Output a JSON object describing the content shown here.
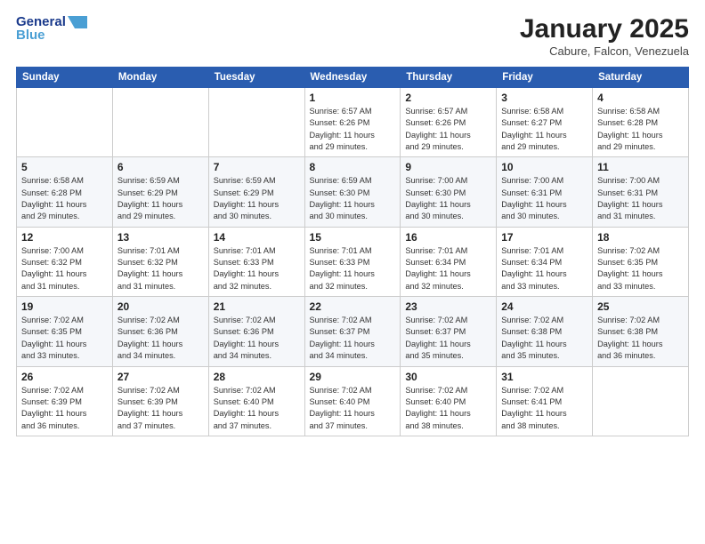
{
  "logo": {
    "line1": "General",
    "line2": "Blue"
  },
  "title": "January 2025",
  "subtitle": "Cabure, Falcon, Venezuela",
  "days_of_week": [
    "Sunday",
    "Monday",
    "Tuesday",
    "Wednesday",
    "Thursday",
    "Friday",
    "Saturday"
  ],
  "weeks": [
    [
      {
        "num": "",
        "info": ""
      },
      {
        "num": "",
        "info": ""
      },
      {
        "num": "",
        "info": ""
      },
      {
        "num": "1",
        "info": "Sunrise: 6:57 AM\nSunset: 6:26 PM\nDaylight: 11 hours\nand 29 minutes."
      },
      {
        "num": "2",
        "info": "Sunrise: 6:57 AM\nSunset: 6:26 PM\nDaylight: 11 hours\nand 29 minutes."
      },
      {
        "num": "3",
        "info": "Sunrise: 6:58 AM\nSunset: 6:27 PM\nDaylight: 11 hours\nand 29 minutes."
      },
      {
        "num": "4",
        "info": "Sunrise: 6:58 AM\nSunset: 6:28 PM\nDaylight: 11 hours\nand 29 minutes."
      }
    ],
    [
      {
        "num": "5",
        "info": "Sunrise: 6:58 AM\nSunset: 6:28 PM\nDaylight: 11 hours\nand 29 minutes."
      },
      {
        "num": "6",
        "info": "Sunrise: 6:59 AM\nSunset: 6:29 PM\nDaylight: 11 hours\nand 29 minutes."
      },
      {
        "num": "7",
        "info": "Sunrise: 6:59 AM\nSunset: 6:29 PM\nDaylight: 11 hours\nand 30 minutes."
      },
      {
        "num": "8",
        "info": "Sunrise: 6:59 AM\nSunset: 6:30 PM\nDaylight: 11 hours\nand 30 minutes."
      },
      {
        "num": "9",
        "info": "Sunrise: 7:00 AM\nSunset: 6:30 PM\nDaylight: 11 hours\nand 30 minutes."
      },
      {
        "num": "10",
        "info": "Sunrise: 7:00 AM\nSunset: 6:31 PM\nDaylight: 11 hours\nand 30 minutes."
      },
      {
        "num": "11",
        "info": "Sunrise: 7:00 AM\nSunset: 6:31 PM\nDaylight: 11 hours\nand 31 minutes."
      }
    ],
    [
      {
        "num": "12",
        "info": "Sunrise: 7:00 AM\nSunset: 6:32 PM\nDaylight: 11 hours\nand 31 minutes."
      },
      {
        "num": "13",
        "info": "Sunrise: 7:01 AM\nSunset: 6:32 PM\nDaylight: 11 hours\nand 31 minutes."
      },
      {
        "num": "14",
        "info": "Sunrise: 7:01 AM\nSunset: 6:33 PM\nDaylight: 11 hours\nand 32 minutes."
      },
      {
        "num": "15",
        "info": "Sunrise: 7:01 AM\nSunset: 6:33 PM\nDaylight: 11 hours\nand 32 minutes."
      },
      {
        "num": "16",
        "info": "Sunrise: 7:01 AM\nSunset: 6:34 PM\nDaylight: 11 hours\nand 32 minutes."
      },
      {
        "num": "17",
        "info": "Sunrise: 7:01 AM\nSunset: 6:34 PM\nDaylight: 11 hours\nand 33 minutes."
      },
      {
        "num": "18",
        "info": "Sunrise: 7:02 AM\nSunset: 6:35 PM\nDaylight: 11 hours\nand 33 minutes."
      }
    ],
    [
      {
        "num": "19",
        "info": "Sunrise: 7:02 AM\nSunset: 6:35 PM\nDaylight: 11 hours\nand 33 minutes."
      },
      {
        "num": "20",
        "info": "Sunrise: 7:02 AM\nSunset: 6:36 PM\nDaylight: 11 hours\nand 34 minutes."
      },
      {
        "num": "21",
        "info": "Sunrise: 7:02 AM\nSunset: 6:36 PM\nDaylight: 11 hours\nand 34 minutes."
      },
      {
        "num": "22",
        "info": "Sunrise: 7:02 AM\nSunset: 6:37 PM\nDaylight: 11 hours\nand 34 minutes."
      },
      {
        "num": "23",
        "info": "Sunrise: 7:02 AM\nSunset: 6:37 PM\nDaylight: 11 hours\nand 35 minutes."
      },
      {
        "num": "24",
        "info": "Sunrise: 7:02 AM\nSunset: 6:38 PM\nDaylight: 11 hours\nand 35 minutes."
      },
      {
        "num": "25",
        "info": "Sunrise: 7:02 AM\nSunset: 6:38 PM\nDaylight: 11 hours\nand 36 minutes."
      }
    ],
    [
      {
        "num": "26",
        "info": "Sunrise: 7:02 AM\nSunset: 6:39 PM\nDaylight: 11 hours\nand 36 minutes."
      },
      {
        "num": "27",
        "info": "Sunrise: 7:02 AM\nSunset: 6:39 PM\nDaylight: 11 hours\nand 37 minutes."
      },
      {
        "num": "28",
        "info": "Sunrise: 7:02 AM\nSunset: 6:40 PM\nDaylight: 11 hours\nand 37 minutes."
      },
      {
        "num": "29",
        "info": "Sunrise: 7:02 AM\nSunset: 6:40 PM\nDaylight: 11 hours\nand 37 minutes."
      },
      {
        "num": "30",
        "info": "Sunrise: 7:02 AM\nSunset: 6:40 PM\nDaylight: 11 hours\nand 38 minutes."
      },
      {
        "num": "31",
        "info": "Sunrise: 7:02 AM\nSunset: 6:41 PM\nDaylight: 11 hours\nand 38 minutes."
      },
      {
        "num": "",
        "info": ""
      }
    ]
  ]
}
